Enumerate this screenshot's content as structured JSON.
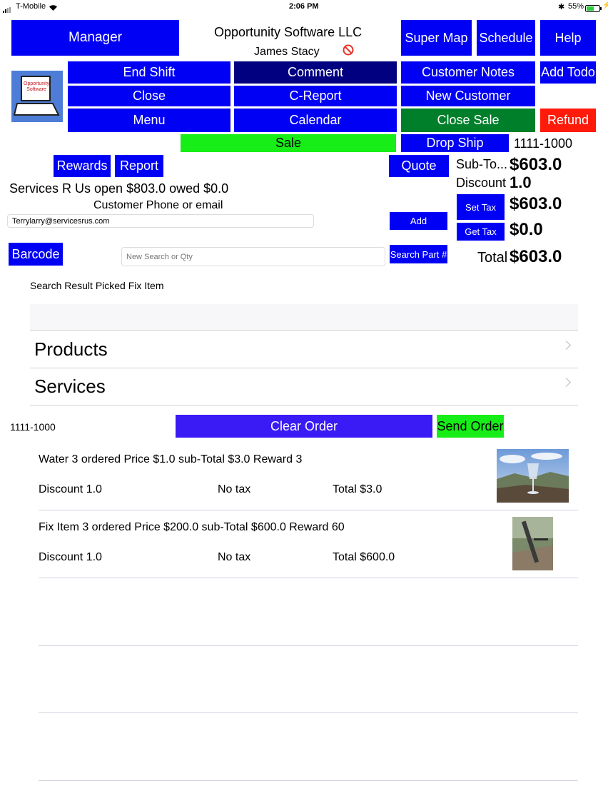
{
  "status_bar": {
    "carrier": "T-Mobile",
    "time": "2:06 PM",
    "battery": "55%"
  },
  "header": {
    "company": "Opportunity Software LLC",
    "user": "James Stacy",
    "logo_text": "Opportunity Software"
  },
  "buttons": {
    "manager": "Manager",
    "super_map": "Super Map",
    "schedule": "Schedule",
    "help": "Help",
    "end_shift": "End Shift",
    "comment": "Comment",
    "customer_notes": "Customer Notes",
    "add_todo": "Add Todo",
    "close": "Close",
    "c_report": "C-Report",
    "new_customer": "New Customer",
    "menu": "Menu",
    "calendar": "Calendar",
    "close_sale": "Close Sale",
    "refund": "Refund",
    "sale": "Sale",
    "drop_ship": "Drop Ship",
    "rewards": "Rewards",
    "report": "Report",
    "quote": "Quote",
    "add": "Add",
    "set_tax": "Set Tax",
    "get_tax": "Get Tax",
    "barcode": "Barcode",
    "search_part": "Search Part #",
    "clear_order": "Clear Order",
    "send_order": "Send Order"
  },
  "order_number": "1111-1000",
  "customer": {
    "summary": "Services R Us  open $803.0 owed $0.0",
    "phone_label": "Customer Phone or email",
    "email_value": "Terrylarry@servicesrus.com"
  },
  "search": {
    "placeholder": "New Search or Qty",
    "result_label": "Search Result Picked Fix Item"
  },
  "totals": {
    "subtotal_label": "Sub-To...",
    "subtotal_value": "$603.0",
    "discount_label": "Discount",
    "discount_value": "1.0",
    "tax_value": "$603.0",
    "get_tax_value": "$0.0",
    "total_label": "Total",
    "total_value": "$603.0"
  },
  "categories": [
    "Products",
    "Services"
  ],
  "order_ref": "1111-1000",
  "order_items": [
    {
      "line1": "Water   3 ordered    Price $1.0   sub-Total $3.0   Reward 3",
      "discount": "Discount 1.0",
      "tax": "No tax",
      "total": "Total $3.0",
      "image": "water-glass-photo"
    },
    {
      "line1": "Fix Item   3 ordered    Price $200.0   sub-Total $600.0   Reward 60",
      "discount": "Discount 1.0",
      "tax": "No tax",
      "total": "Total $600.0",
      "image": "fix-item-photo"
    }
  ],
  "colors": {
    "blue": "#0000f5",
    "navy": "#000080",
    "green_dark": "#007f2a",
    "green_bright": "#17ee17",
    "red": "#ff1a0a",
    "clear_order": "#3a1af5"
  }
}
